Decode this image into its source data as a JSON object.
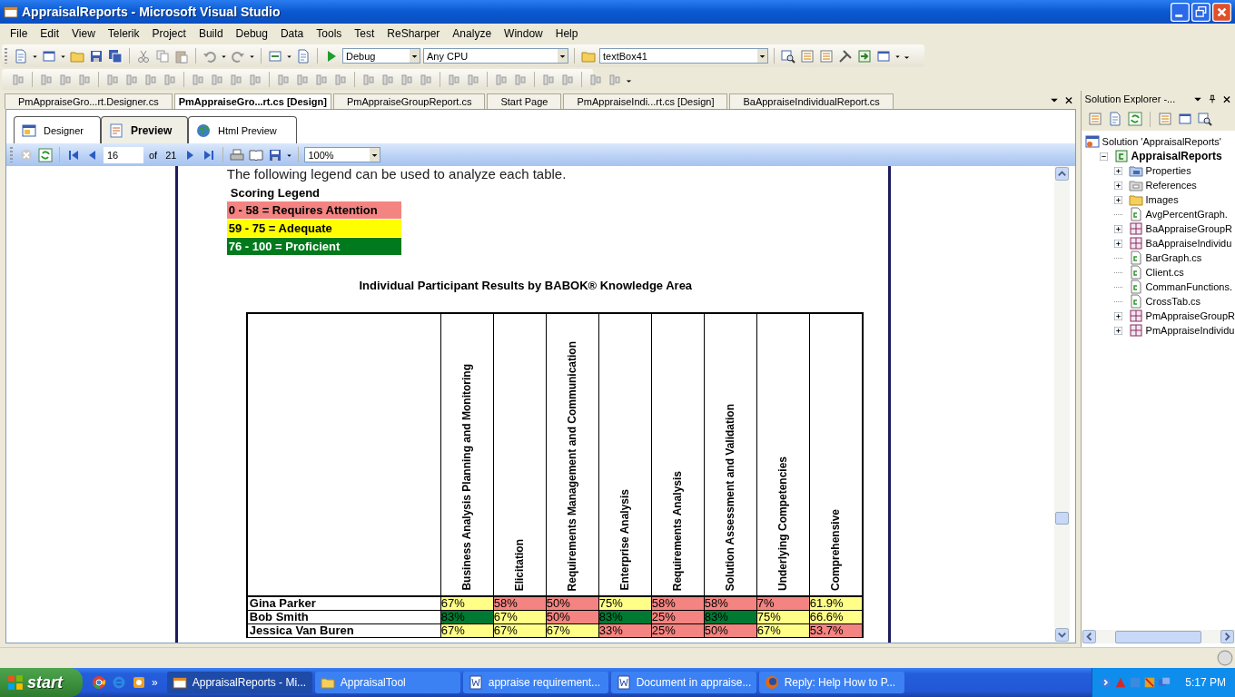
{
  "window": {
    "title": "AppraisalReports - Microsoft Visual Studio"
  },
  "menu": [
    "File",
    "Edit",
    "View",
    "Telerik",
    "Project",
    "Build",
    "Debug",
    "Data",
    "Tools",
    "Test",
    "ReSharper",
    "Analyze",
    "Window",
    "Help"
  ],
  "toolbar": {
    "configuration": "Debug",
    "platform": "Any CPU",
    "object": "textBox41"
  },
  "doc_tabs": [
    {
      "label": "PmAppraiseGro...rt.Designer.cs",
      "selected": false
    },
    {
      "label": "PmAppraiseGro...rt.cs [Design]",
      "selected": true
    },
    {
      "label": "PmAppraiseGroupReport.cs",
      "selected": false
    },
    {
      "label": "Start Page",
      "selected": false
    },
    {
      "label": "PmAppraiseIndi...rt.cs [Design]",
      "selected": false
    },
    {
      "label": "BaAppraiseIndividualReport.cs",
      "selected": false
    }
  ],
  "view_tabs": [
    {
      "label": "Designer",
      "kind": "designer",
      "selected": false
    },
    {
      "label": "Preview",
      "kind": "preview",
      "selected": true
    },
    {
      "label": "Html Preview",
      "kind": "html",
      "selected": false
    }
  ],
  "report_toolbar": {
    "page": "16",
    "of": "of",
    "total": "21",
    "zoom": "100%"
  },
  "report": {
    "intro": "The following legend can be used to analyze each table.",
    "legend": {
      "title": "Scoring Legend",
      "items": [
        {
          "label": "0 - 58 =  Requires Attention",
          "color": "#f48481"
        },
        {
          "label": "59 - 75 = Adequate",
          "color": "#ffff00"
        },
        {
          "label": "76 - 100 = Proficient",
          "color": "#007a1c"
        }
      ]
    },
    "table_title": "Individual Participant Results by BABOK® Knowledge Area",
    "columns": [
      "Business Analysis Planning and Monitoring",
      "Elicitation",
      "Requirements Management and Communication",
      "Enterprise Analysis",
      "Requirements Analysis",
      "Solution Assessment and Validation",
      "Underlying Competencies",
      "Comprehensive"
    ],
    "rows": [
      {
        "name": "Gina Parker",
        "cells": [
          {
            "text": "67%",
            "color": "#ffff88"
          },
          {
            "text": "58%",
            "color": "#f48481"
          },
          {
            "text": "50%",
            "color": "#f48481"
          },
          {
            "text": "75%",
            "color": "#ffff88"
          },
          {
            "text": "58%",
            "color": "#f48481"
          },
          {
            "text": "58%",
            "color": "#f48481"
          },
          {
            "text": "7%",
            "color": "#f48481"
          },
          {
            "text": "61.9%",
            "color": "#ffff88"
          }
        ]
      },
      {
        "name": "Bob Smith",
        "cells": [
          {
            "text": "83%",
            "color": "#007a33"
          },
          {
            "text": "67%",
            "color": "#ffff88"
          },
          {
            "text": "50%",
            "color": "#f48481"
          },
          {
            "text": "83%",
            "color": "#007a33"
          },
          {
            "text": "25%",
            "color": "#f48481"
          },
          {
            "text": "83%",
            "color": "#007a33"
          },
          {
            "text": "75%",
            "color": "#ffff88"
          },
          {
            "text": "66.6%",
            "color": "#ffff88"
          }
        ]
      },
      {
        "name": "Jessica Van Buren",
        "cells": [
          {
            "text": "67%",
            "color": "#ffff88"
          },
          {
            "text": "67%",
            "color": "#ffff88"
          },
          {
            "text": "67%",
            "color": "#ffff88"
          },
          {
            "text": "33%",
            "color": "#f48481"
          },
          {
            "text": "25%",
            "color": "#f48481"
          },
          {
            "text": "50%",
            "color": "#f48481"
          },
          {
            "text": "67%",
            "color": "#ffff88"
          },
          {
            "text": "53.7%",
            "color": "#f48481"
          }
        ]
      }
    ]
  },
  "solution_explorer": {
    "title": "Solution Explorer -...",
    "items": [
      {
        "label": "Solution 'AppraisalReports'",
        "kind": "solution",
        "children": [
          {
            "label": "AppraisalReports",
            "kind": "project",
            "expanded": true,
            "children": [
              {
                "label": "Properties",
                "kind": "properties",
                "expanded": false
              },
              {
                "label": "References",
                "kind": "references",
                "expanded": false
              },
              {
                "label": "Images",
                "kind": "folder",
                "expanded": false
              },
              {
                "label": "AvgPercentGraph.",
                "kind": "cs"
              },
              {
                "label": "BaAppraiseGroupR",
                "kind": "report",
                "expanded": false
              },
              {
                "label": "BaAppraiseIndividu",
                "kind": "report",
                "expanded": false
              },
              {
                "label": "BarGraph.cs",
                "kind": "cs"
              },
              {
                "label": "Client.cs",
                "kind": "cs"
              },
              {
                "label": "CommanFunctions.",
                "kind": "cs"
              },
              {
                "label": "CrossTab.cs",
                "kind": "cs"
              },
              {
                "label": "PmAppraiseGroupR",
                "kind": "report",
                "expanded": false
              },
              {
                "label": "PmAppraiseIndividu",
                "kind": "report",
                "expanded": false
              }
            ]
          }
        ]
      }
    ]
  },
  "taskbar": {
    "start": "start",
    "more": "»",
    "tasks": [
      {
        "label": "AppraisalReports - Mi...",
        "kind": "vs",
        "selected": true
      },
      {
        "label": "AppraisalTool",
        "kind": "folder",
        "selected": false
      },
      {
        "label": "appraise requirement...",
        "kind": "word",
        "selected": false
      },
      {
        "label": "Document in appraise...",
        "kind": "word",
        "selected": false
      },
      {
        "label": "Reply: Help How to P...",
        "kind": "firefox",
        "selected": false
      }
    ],
    "time": "5:17 PM"
  }
}
